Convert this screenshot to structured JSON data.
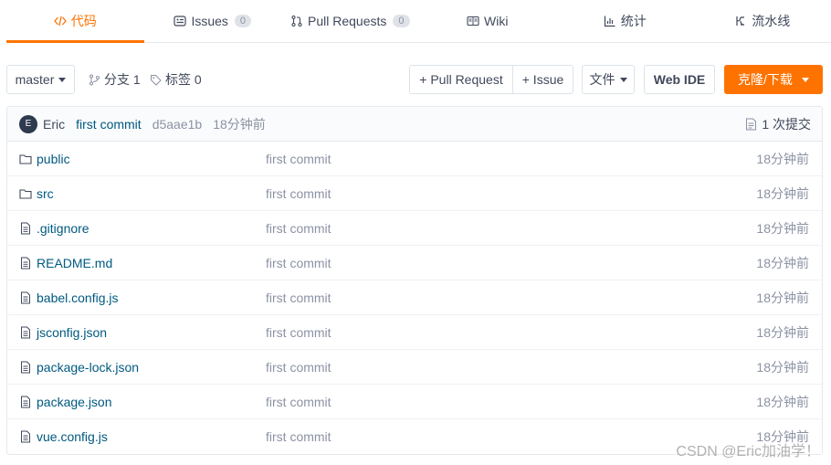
{
  "tabs": [
    {
      "label": "代码",
      "icon": "code-icon",
      "active": true
    },
    {
      "label": "Issues",
      "icon": "issues-icon",
      "badge": "0"
    },
    {
      "label": "Pull Requests",
      "icon": "pull-request-icon",
      "badge": "0"
    },
    {
      "label": "Wiki",
      "icon": "wiki-icon"
    },
    {
      "label": "统计",
      "icon": "stats-icon"
    },
    {
      "label": "流水线",
      "icon": "pipeline-icon"
    }
  ],
  "toolbar": {
    "branch": "master",
    "branches": "分支 1",
    "tags": "标签 0",
    "pull_request": "+ Pull Request",
    "issue": "+ Issue",
    "file": "文件",
    "web_ide": "Web IDE",
    "clone": "克隆/下载"
  },
  "commit": {
    "avatar": "E",
    "author": "Eric",
    "message": "first commit",
    "sha": "d5aae1b",
    "time": "18分钟前",
    "count": "1 次提交"
  },
  "files": [
    {
      "name": "public",
      "type": "folder",
      "message": "first commit",
      "time": "18分钟前"
    },
    {
      "name": "src",
      "type": "folder",
      "message": "first commit",
      "time": "18分钟前"
    },
    {
      "name": ".gitignore",
      "type": "file",
      "message": "first commit",
      "time": "18分钟前"
    },
    {
      "name": "README.md",
      "type": "file",
      "message": "first commit",
      "time": "18分钟前"
    },
    {
      "name": "babel.config.js",
      "type": "file",
      "message": "first commit",
      "time": "18分钟前"
    },
    {
      "name": "jsconfig.json",
      "type": "file",
      "message": "first commit",
      "time": "18分钟前"
    },
    {
      "name": "package-lock.json",
      "type": "file",
      "message": "first commit",
      "time": "18分钟前"
    },
    {
      "name": "package.json",
      "type": "file",
      "message": "first commit",
      "time": "18分钟前"
    },
    {
      "name": "vue.config.js",
      "type": "file",
      "message": "first commit",
      "time": "18分钟前"
    }
  ],
  "watermark": "CSDN @Eric加油学！",
  "colors": {
    "accent": "#fe7300",
    "link": "#005980",
    "muted": "#8c92a4"
  }
}
